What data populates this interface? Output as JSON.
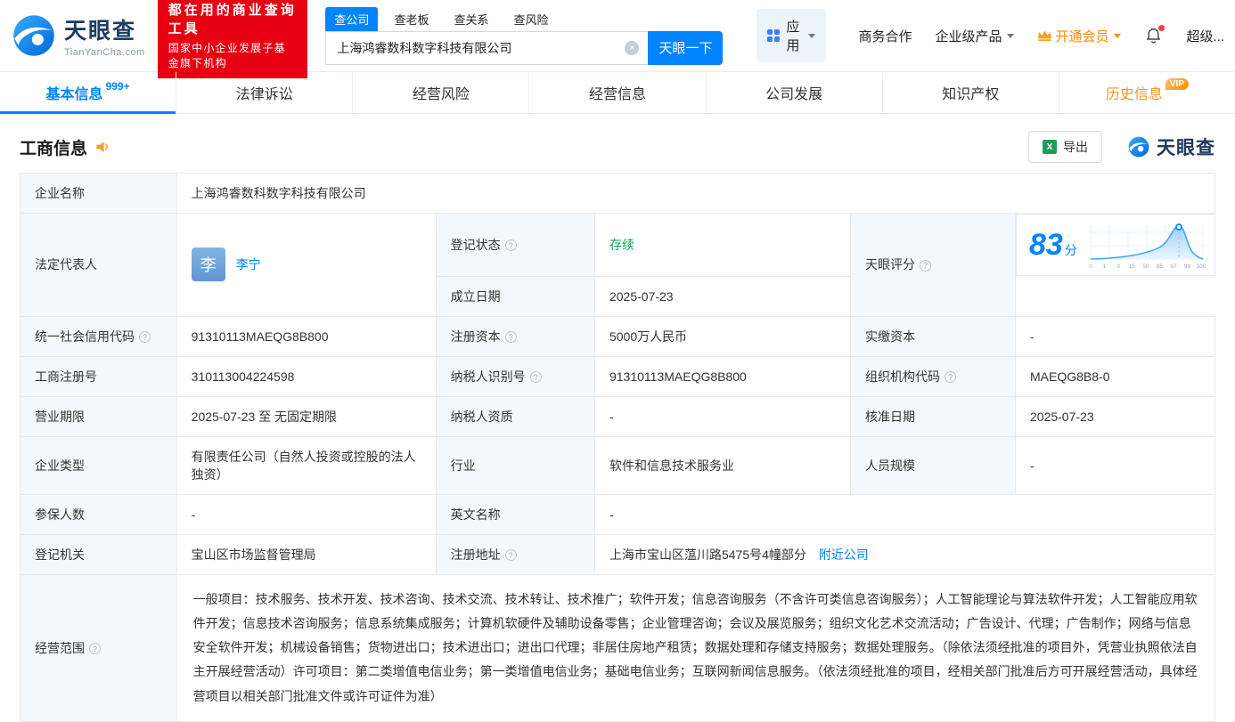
{
  "header": {
    "logo": {
      "title": "天眼查",
      "domain": "TianYanCha.com"
    },
    "promo_badge": {
      "line1": "都在用的商业查询工具",
      "line2": "国家中小企业发展子基金旗下机构"
    },
    "search": {
      "tabs": [
        "查公司",
        "查老板",
        "查关系",
        "查风险"
      ],
      "value": "上海鸿睿数科数字科技有限公司",
      "submit_label": "天眼一下"
    },
    "nav": {
      "apps": "应用",
      "cooperation": "商务合作",
      "enterprise_products": "企业级产品",
      "membership": "开通会员",
      "super": "超级..."
    }
  },
  "tabbar": [
    {
      "label": "基本信息",
      "count": "999+"
    },
    {
      "label": "法律诉讼"
    },
    {
      "label": "经营风险"
    },
    {
      "label": "经营信息"
    },
    {
      "label": "公司发展"
    },
    {
      "label": "知识产权"
    },
    {
      "label": "历史信息",
      "vip": "VIP"
    }
  ],
  "section": {
    "title": "工商信息",
    "export_label": "导出",
    "brand": "天眼查"
  },
  "table": {
    "labels": {
      "company_name": "企业名称",
      "legal_rep": "法定代表人",
      "reg_status": "登记状态",
      "score": "天眼评分",
      "establish_date": "成立日期",
      "credit_code": "统一社会信用代码",
      "reg_capital": "注册资本",
      "paid_capital": "实缴资本",
      "reg_number": "工商注册号",
      "taxpayer_id": "纳税人识别号",
      "org_code": "组织机构代码",
      "business_term": "营业期限",
      "taxpayer_quality": "纳税人资质",
      "approval_date": "核准日期",
      "company_type": "企业类型",
      "industry": "行业",
      "staff_size": "人员规模",
      "insured_count": "参保人数",
      "english_name": "英文名称",
      "reg_authority": "登记机关",
      "reg_address": "注册地址",
      "business_scope": "经营范围"
    },
    "values": {
      "company_name": "上海鸿睿数科数字科技有限公司",
      "legal_rep_avatar": "李",
      "legal_rep": "李宁",
      "reg_status": "存续",
      "establish_date": "2025-07-23",
      "credit_code": "91310113MAEQG8B800",
      "reg_capital": "5000万人民币",
      "paid_capital": "-",
      "reg_number": "310113004224598",
      "taxpayer_id": "91310113MAEQG8B800",
      "org_code": "MAEQG8B8-0",
      "business_term": "2025-07-23 至 无固定期限",
      "taxpayer_quality": "-",
      "approval_date": "2025-07-23",
      "company_type": "有限责任公司（自然人投资或控股的法人独资）",
      "industry": "软件和信息技术服务业",
      "staff_size": "-",
      "insured_count": "-",
      "english_name": "-",
      "reg_authority": "宝山区市场监督管理局",
      "reg_address": "上海市宝山区蕰川路5475号4幢部分",
      "nearby": "附近公司",
      "business_scope": "一般项目：技术服务、技术开发、技术咨询、技术交流、技术转让、技术推广；软件开发；信息咨询服务（不含许可类信息咨询服务）；人工智能理论与算法软件开发；人工智能应用软件开发；信息技术咨询服务；信息系统集成服务；计算机软硬件及辅助设备零售；企业管理咨询；会议及展览服务；组织文化艺术交流活动；广告设计、代理；广告制作；网络与信息安全软件开发；机械设备销售；货物进出口；技术进出口；进出口代理；非居住房地产租赁；数据处理和存储支持服务；数据处理服务。（除依法须经批准的项目外，凭营业执照依法自主开展经营活动）许可项目：第二类增值电信业务；第一类增值电信业务；基础电信业务；互联网新闻信息服务。（依法须经批准的项目，经相关部门批准后方可开展经营活动，具体经营项目以相关部门批准文件或许可证件为准）"
    },
    "score": {
      "value": "83",
      "unit": "分",
      "ticks": [
        "0",
        "1",
        "3",
        "15",
        "50",
        "85",
        "97",
        "99",
        "100"
      ]
    }
  },
  "icons": {
    "info": "?",
    "clear": "×",
    "excel": "X"
  },
  "colors": {
    "primary_blue": "#0084ff",
    "badge_red": "#e60012",
    "vip_orange": "#ff8a00",
    "status_green": "#00a854",
    "label_bg": "#f2f8fe"
  }
}
